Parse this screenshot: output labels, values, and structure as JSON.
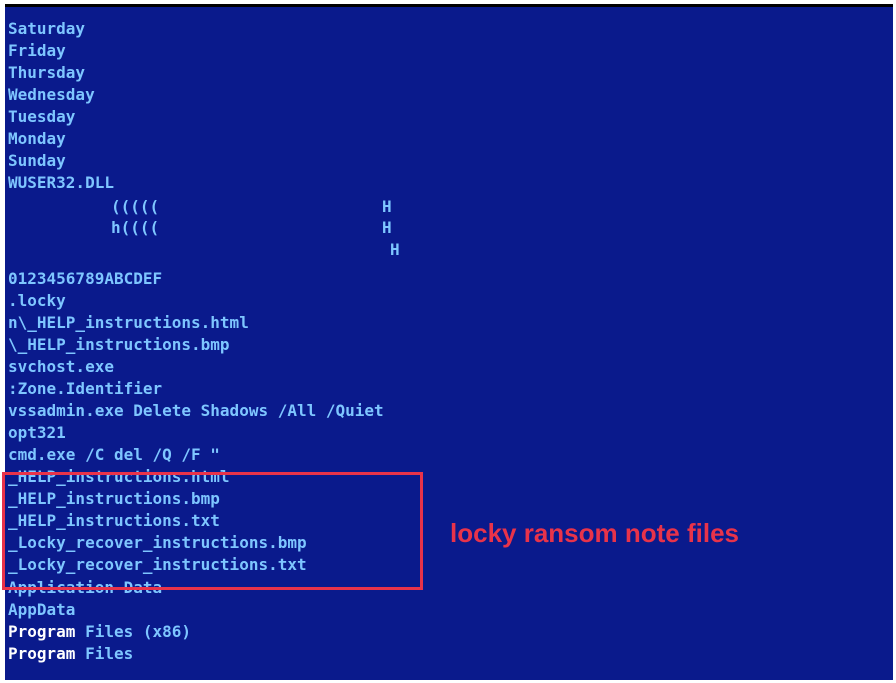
{
  "console": {
    "lines": [
      "Saturday",
      "Friday",
      "Thursday",
      "Wednesday",
      "Tuesday",
      "Monday",
      "Sunday",
      "WUSER32.DLL",
      "0123456789ABCDEF",
      ".locky",
      "n\\_HELP_instructions.html",
      "\\_HELP_instructions.bmp",
      "svchost.exe",
      ":Zone.Identifier",
      "vssadmin.exe Delete Shadows /All /Quiet",
      "opt321",
      "cmd.exe /C del /Q /F \"",
      "_HELP_instructions.html",
      "_HELP_instructions.bmp",
      "_HELP_instructions.txt",
      "_Locky_recover_instructions.bmp",
      "_Locky_recover_instructions.txt",
      "Application Data",
      "AppData"
    ],
    "program_files_x86": {
      "word1": "Program",
      "word2": " Files (x86)"
    },
    "program_files": {
      "word1": "Program",
      "word2": " Files"
    },
    "hex_fragments": {
      "row1_left": "((((( ",
      "row1_right": "H",
      "row2_left": "h(((( ",
      "row2_right": "H",
      "row3_right": "H"
    }
  },
  "annotation": {
    "text": "locky ransom note files",
    "color": "#e8334a"
  },
  "colors": {
    "background": "#0a1a8c",
    "text": "#7ec6ff",
    "highlight": "#e8334a"
  }
}
